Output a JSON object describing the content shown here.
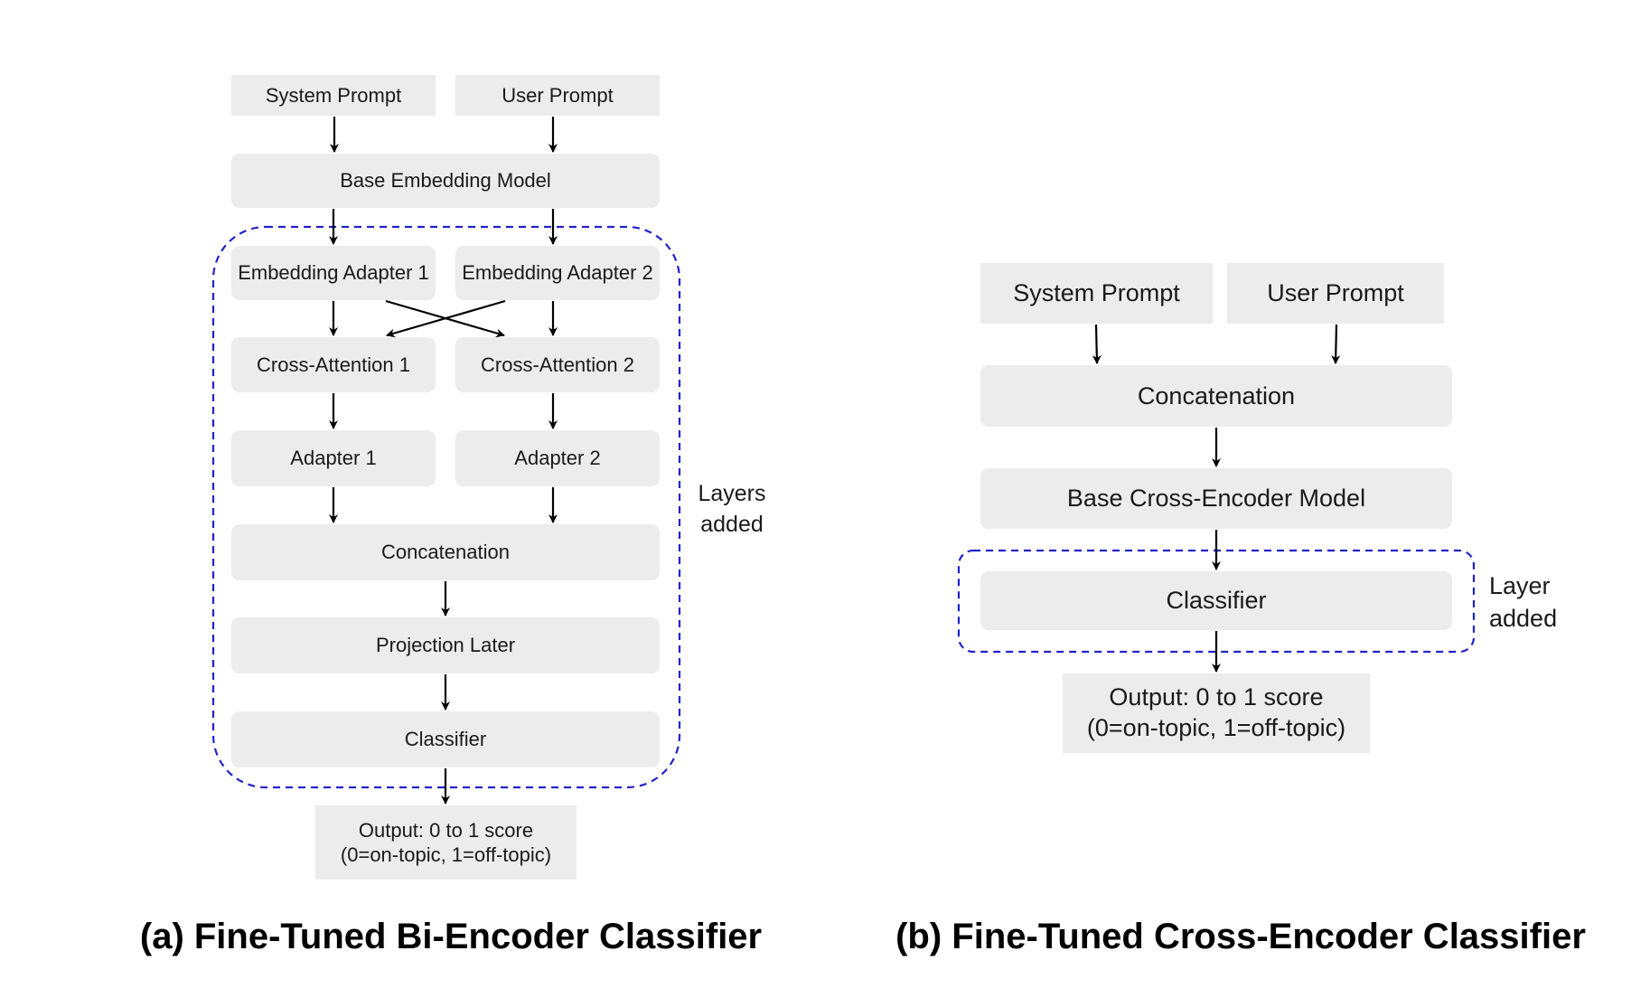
{
  "figure": {
    "panel_a": {
      "caption": "(a) Fine-Tuned Bi-Encoder Classifier",
      "nodes": {
        "system_prompt": "System Prompt",
        "user_prompt": "User Prompt",
        "base_embedding_model": "Base Embedding Model",
        "embedding_adapter_1": "Embedding Adapter 1",
        "embedding_adapter_2": "Embedding Adapter 2",
        "cross_attention_1": "Cross-Attention 1",
        "cross_attention_2": "Cross-Attention 2",
        "adapter_1": "Adapter 1",
        "adapter_2": "Adapter 2",
        "concatenation": "Concatenation",
        "projection_layer": "Projection Later",
        "classifier": "Classifier",
        "output_line1": "Output: 0 to 1 score",
        "output_line2": "(0=on-topic, 1=off-topic)"
      },
      "group_label_line1": "Layers",
      "group_label_line2": "added"
    },
    "panel_b": {
      "caption": "(b) Fine-Tuned Cross-Encoder Classifier",
      "nodes": {
        "system_prompt": "System Prompt",
        "user_prompt": "User Prompt",
        "concatenation": "Concatenation",
        "base_cross_encoder_model": "Base Cross-Encoder Model",
        "classifier": "Classifier",
        "output_line1": "Output: 0 to 1 score",
        "output_line2": "(0=on-topic, 1=off-topic)"
      },
      "group_label_line1": "Layer",
      "group_label_line2": "added"
    },
    "colors": {
      "node_fill": "#ececec",
      "dashed_group": "#2222cc",
      "arrow": "#000000"
    }
  }
}
